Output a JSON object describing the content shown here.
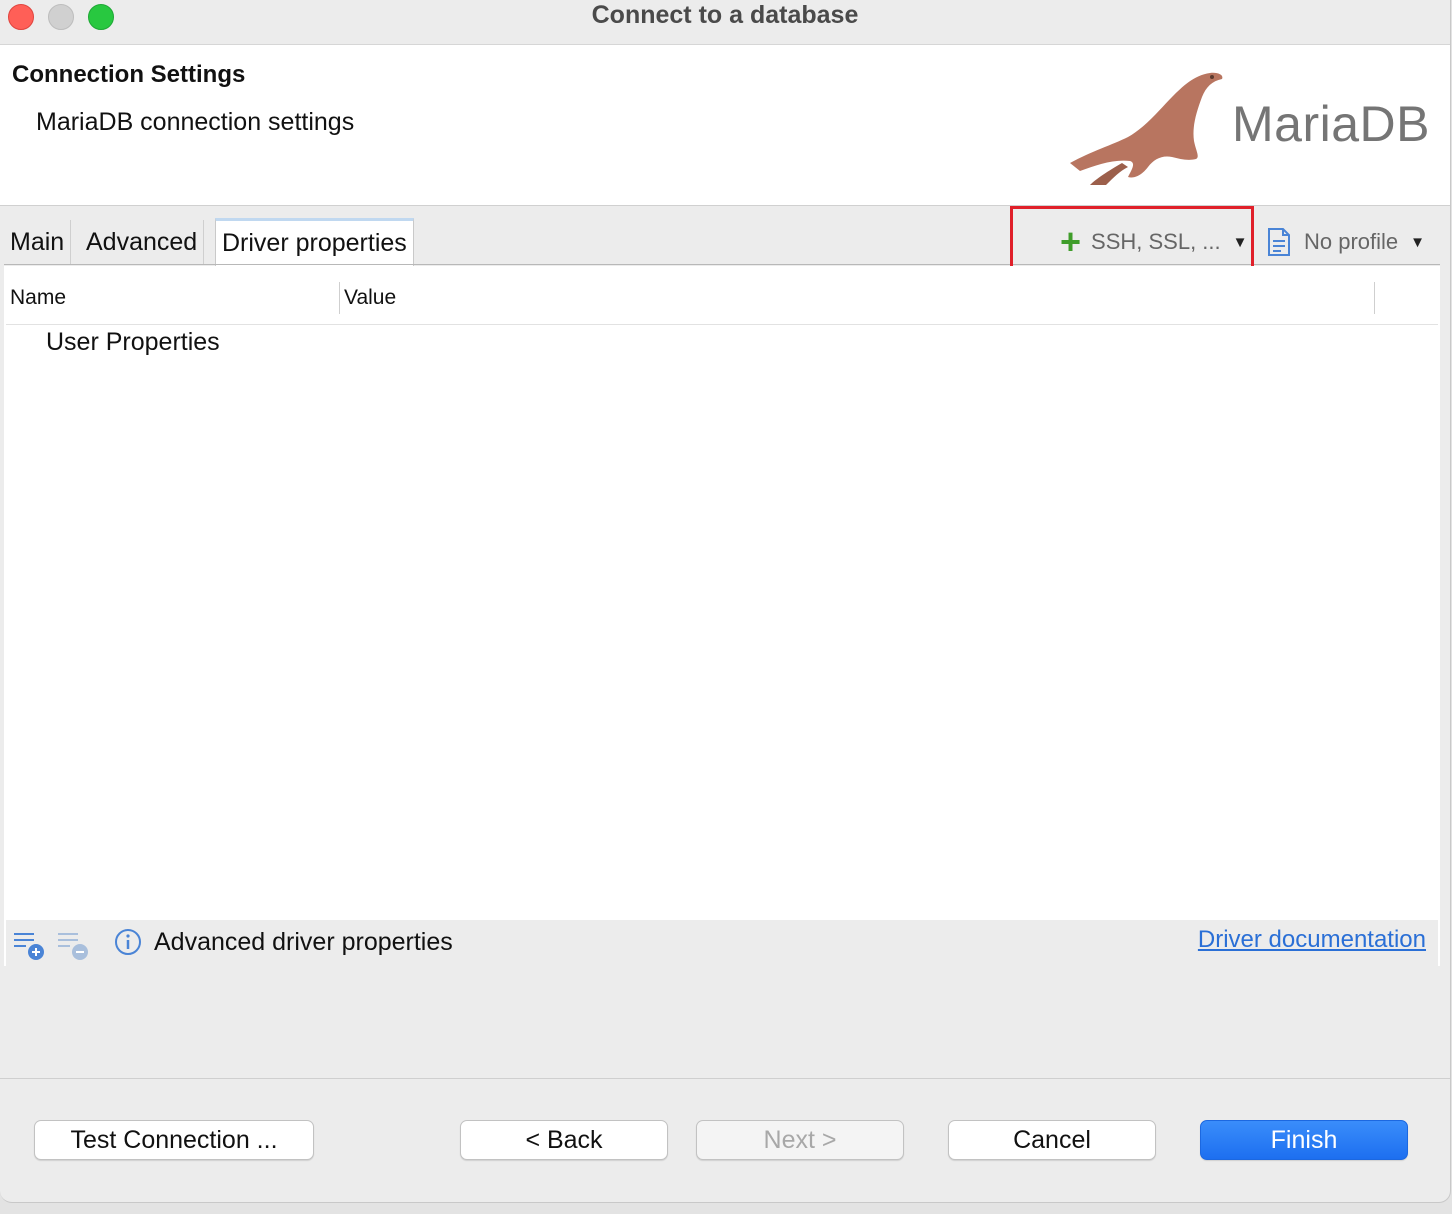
{
  "window": {
    "title": "Connect to a database"
  },
  "header": {
    "title": "Connection Settings",
    "subtitle": "MariaDB connection settings",
    "logo_text": "MariaDB"
  },
  "tabs": [
    {
      "label": "Main"
    },
    {
      "label": "Advanced"
    },
    {
      "label": "Driver properties",
      "active": true
    }
  ],
  "toolbar": {
    "network_label": "SSH, SSL, ...",
    "profile_label": "No profile"
  },
  "table": {
    "columns": [
      "Name",
      "Value"
    ],
    "rows": [
      "User Properties"
    ]
  },
  "footer_bar": {
    "label": "Advanced driver properties",
    "link": "Driver documentation"
  },
  "buttons": {
    "test": "Test Connection ...",
    "back": "< Back",
    "next": "Next >",
    "cancel": "Cancel",
    "finish": "Finish"
  },
  "colors": {
    "accent": "#1d6ff0",
    "highlight": "#e0202a",
    "plus": "#3f9d2a",
    "logo": "#b87560"
  }
}
